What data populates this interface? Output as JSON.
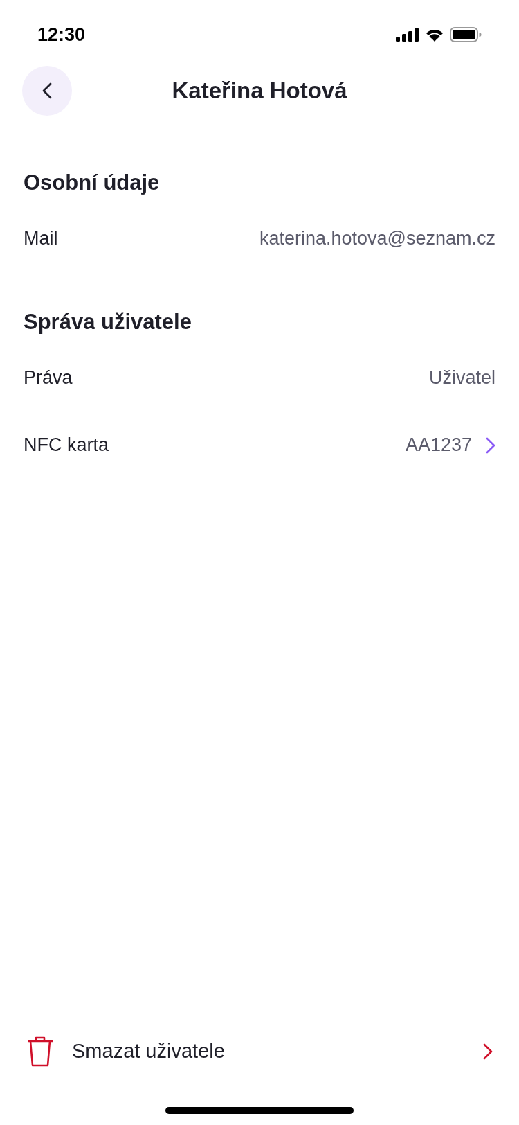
{
  "status_bar": {
    "time": "12:30"
  },
  "header": {
    "title": "Kateřina Hotová"
  },
  "sections": [
    {
      "title": "Osobní údaje",
      "rows": [
        {
          "label": "Mail",
          "value": "katerina.hotova@seznam.cz",
          "kind": "plain"
        }
      ]
    },
    {
      "title": "Správa uživatele",
      "rows": [
        {
          "label": "Práva",
          "value": "Uživatel",
          "kind": "plain"
        },
        {
          "label": "NFC karta",
          "value": "AA1237",
          "kind": "link"
        }
      ]
    }
  ],
  "delete_action": {
    "label": "Smazat uživatele"
  }
}
